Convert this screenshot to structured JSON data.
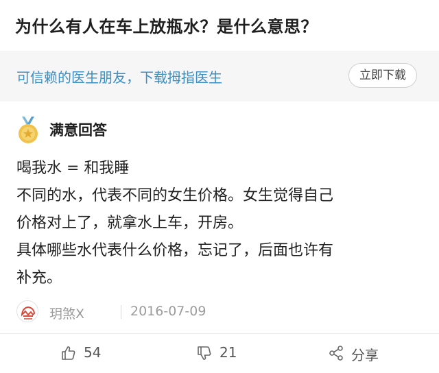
{
  "question": {
    "title": "为什么有人在车上放瓶水？是什么意思？"
  },
  "banner": {
    "text": "可信赖的医生朋友，下载拇指医生",
    "download_label": "立即下载"
  },
  "answer": {
    "badge_label": "满意回答",
    "lines": [
      "喝我水 = 和我睡",
      "不同的水，代表不同的女生价格。女生觉得自己",
      "价格对上了，就拿水上车，开房。",
      "具体哪些水代表什么价格，忘记了，后面也许有",
      "补充。"
    ]
  },
  "author": {
    "name": "玥煞X",
    "date": "2016-07-09"
  },
  "actions": {
    "like_count": "54",
    "dislike_count": "21",
    "share_label": "分享"
  },
  "colors": {
    "banner_text": "#3a8fc4",
    "medal": "#f0c24b",
    "avatar_accent": "#d94a3a"
  },
  "icons": {
    "medal": "medal-icon",
    "avatar": "avatar",
    "like": "thumbs-up-icon",
    "dislike": "thumbs-down-icon",
    "share": "share-icon"
  }
}
